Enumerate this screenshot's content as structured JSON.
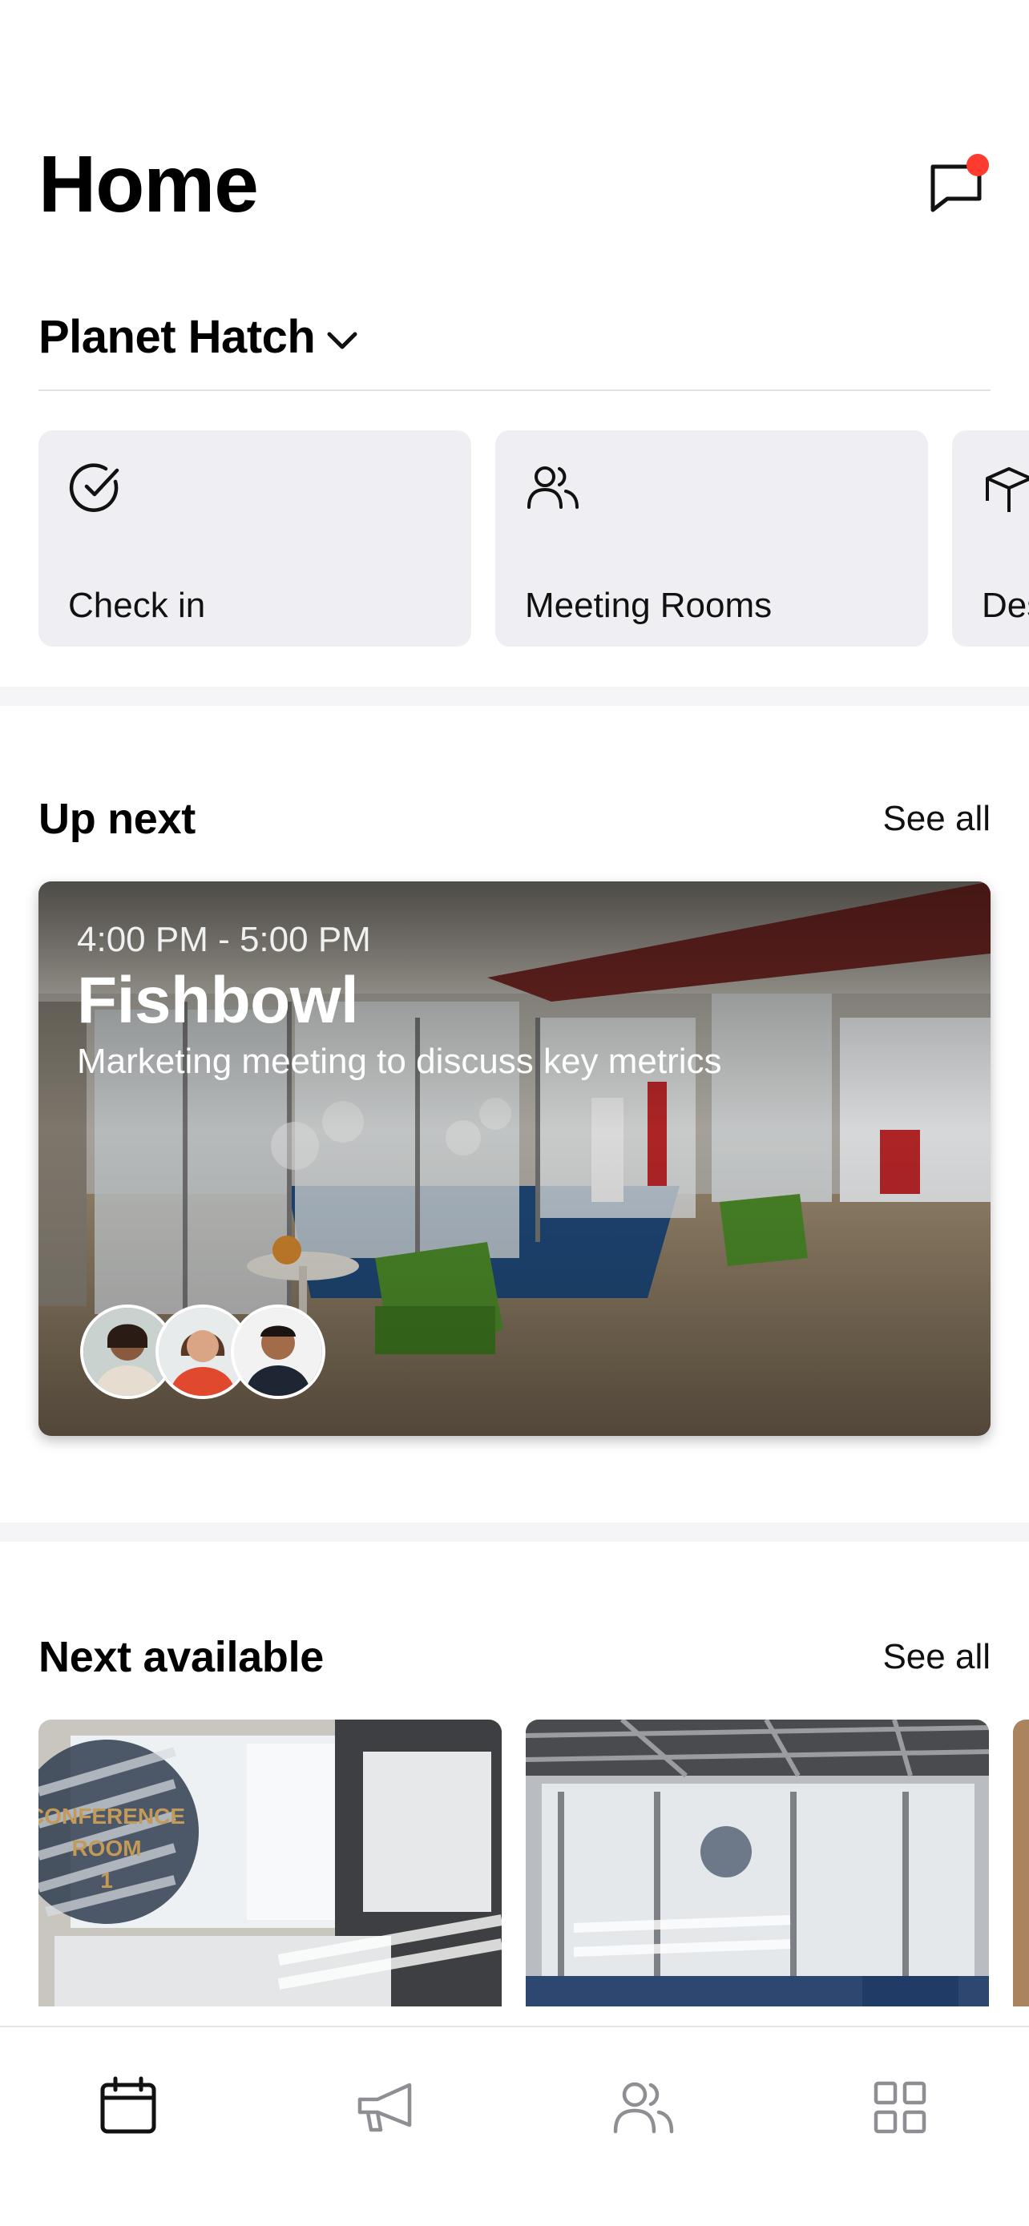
{
  "header": {
    "title": "Home"
  },
  "location": {
    "name": "Planet Hatch"
  },
  "quick_actions": [
    {
      "label": "Check in",
      "icon": "check-circle-icon"
    },
    {
      "label": "Meeting Rooms",
      "icon": "people-icon"
    },
    {
      "label": "Desks",
      "icon": "box-icon"
    }
  ],
  "up_next": {
    "title": "Up next",
    "see_all": "See all",
    "event": {
      "time": "4:00 PM - 5:00 PM",
      "name": "Fishbowl",
      "description": "Marketing meeting to discuss key metrics"
    }
  },
  "next_available": {
    "title": "Next available",
    "see_all": "See all",
    "room_sign": [
      "CONFERENCE",
      "ROOM",
      "1"
    ]
  },
  "tabbar": {
    "tabs": [
      {
        "icon": "calendar-icon",
        "active": true
      },
      {
        "icon": "megaphone-icon",
        "active": false
      },
      {
        "icon": "people-icon",
        "active": false
      },
      {
        "icon": "grid-icon",
        "active": false
      }
    ]
  },
  "colors": {
    "notification_dot": "#ff3b30",
    "card_bg": "#efeff3",
    "inactive_icon": "#8e8e93"
  }
}
